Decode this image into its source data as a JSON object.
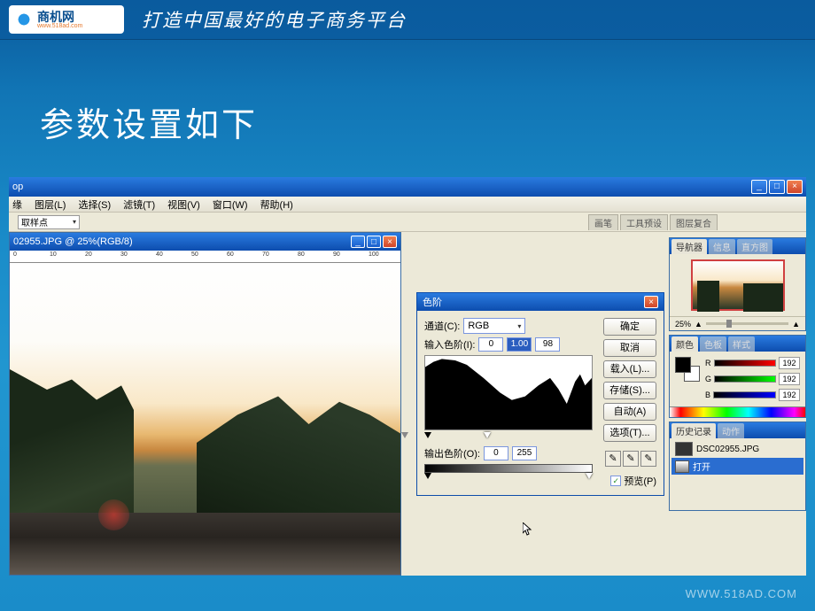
{
  "site": {
    "name_cn": "商机网",
    "name_en": "www.518ad.com",
    "tagline": "打造中国最好的电子商务平台"
  },
  "slide": {
    "title": "参数设置如下",
    "footer": "WWW.518AD.COM"
  },
  "ps": {
    "app_title": "op",
    "menu": [
      "缘",
      "图层(L)",
      "选择(S)",
      "滤镜(T)",
      "视图(V)",
      "窗口(W)",
      "帮助(H)"
    ],
    "tool_preset": "取样点",
    "tool_tabs": [
      "画笔",
      "工具预设",
      "图层复合"
    ],
    "doc_title": "02955.JPG @ 25%(RGB/8)",
    "ruler": [
      0,
      10,
      20,
      30,
      40,
      50,
      60,
      70,
      80,
      90,
      100
    ]
  },
  "levels": {
    "title": "色阶",
    "channel_label": "通道(C):",
    "channel": "RGB",
    "input_label": "输入色阶(I):",
    "input": [
      "0",
      "1.00",
      "98"
    ],
    "output_label": "输出色阶(O):",
    "output": [
      "0",
      "255"
    ],
    "preview": "预览(P)",
    "buttons": {
      "ok": "确定",
      "cancel": "取消",
      "load": "载入(L)...",
      "save": "存储(S)...",
      "auto": "自动(A)",
      "options": "选项(T)..."
    }
  },
  "panels": {
    "navigator": {
      "tabs": [
        "导航器",
        "信息",
        "直方图"
      ],
      "zoom": "25%"
    },
    "color": {
      "tabs": [
        "颜色",
        "色板",
        "样式"
      ],
      "r": "192",
      "g": "192",
      "b": "192"
    },
    "history": {
      "tabs": [
        "历史记录",
        "动作"
      ],
      "file": "DSC02955.JPG",
      "open": "打开"
    }
  }
}
